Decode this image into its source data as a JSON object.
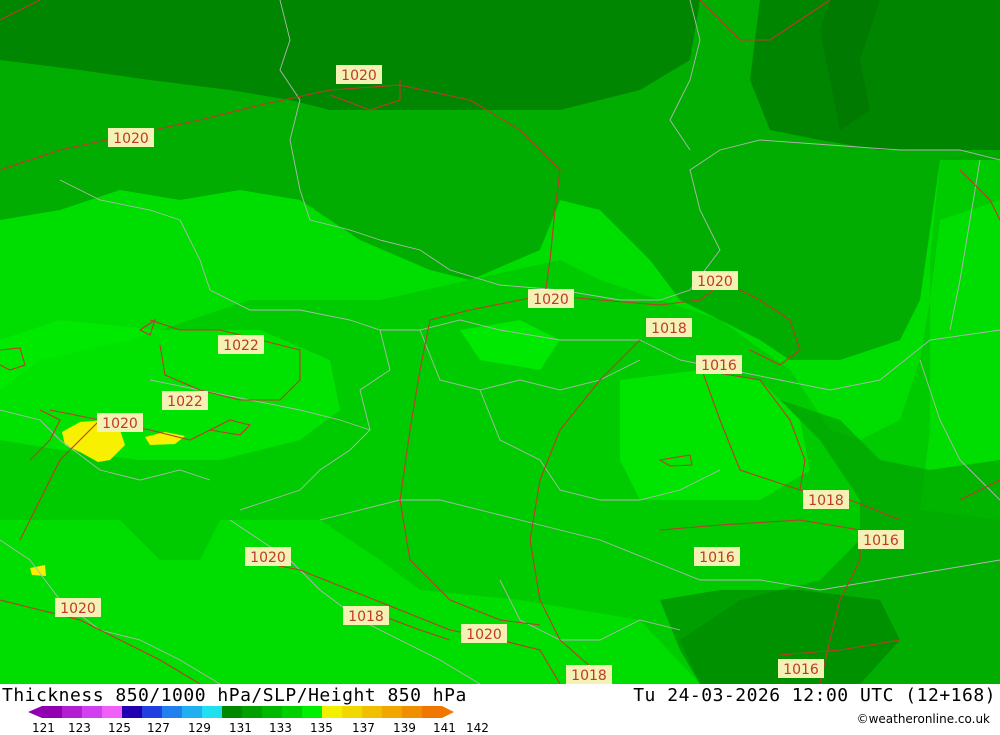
{
  "map": {
    "colors": {
      "bright": "#00dd00",
      "mid": "#00bb00",
      "dark": "#009900",
      "darkest": "#007a00",
      "pale": "#00f000",
      "yellow": "#f7f000",
      "isobar": "#c0392b",
      "border": "#b4b4b4"
    },
    "isobar_labels": [
      "1020",
      "1020",
      "1020",
      "1022",
      "1022",
      "1020",
      "1020",
      "1020",
      "1018",
      "1016",
      "1018",
      "1016",
      "1016",
      "1020",
      "1020",
      "1018",
      "1020",
      "1018",
      "1016"
    ]
  },
  "footer": {
    "title": "Thickness 850/1000 hPa/SLP/Height 850 hPa",
    "datetime": "Tu 24-03-2026 12:00 UTC (12+168)",
    "credit": "©weatheronline.co.uk",
    "colorbar_ticks": [
      "121",
      "123",
      "125",
      "127",
      "129",
      "131",
      "133",
      "135",
      "137",
      "139",
      "141",
      "142"
    ],
    "colorbar_colors": [
      "#9000b0",
      "#b020d0",
      "#d040f0",
      "#f060f8",
      "#2000b0",
      "#2040e0",
      "#2080f0",
      "#20b0f0",
      "#20e0f0",
      "#008800",
      "#00a000",
      "#00b800",
      "#00d000",
      "#00f000",
      "#f0f000",
      "#f0d800",
      "#f0c000",
      "#f0a800",
      "#f09000",
      "#f07800"
    ]
  }
}
